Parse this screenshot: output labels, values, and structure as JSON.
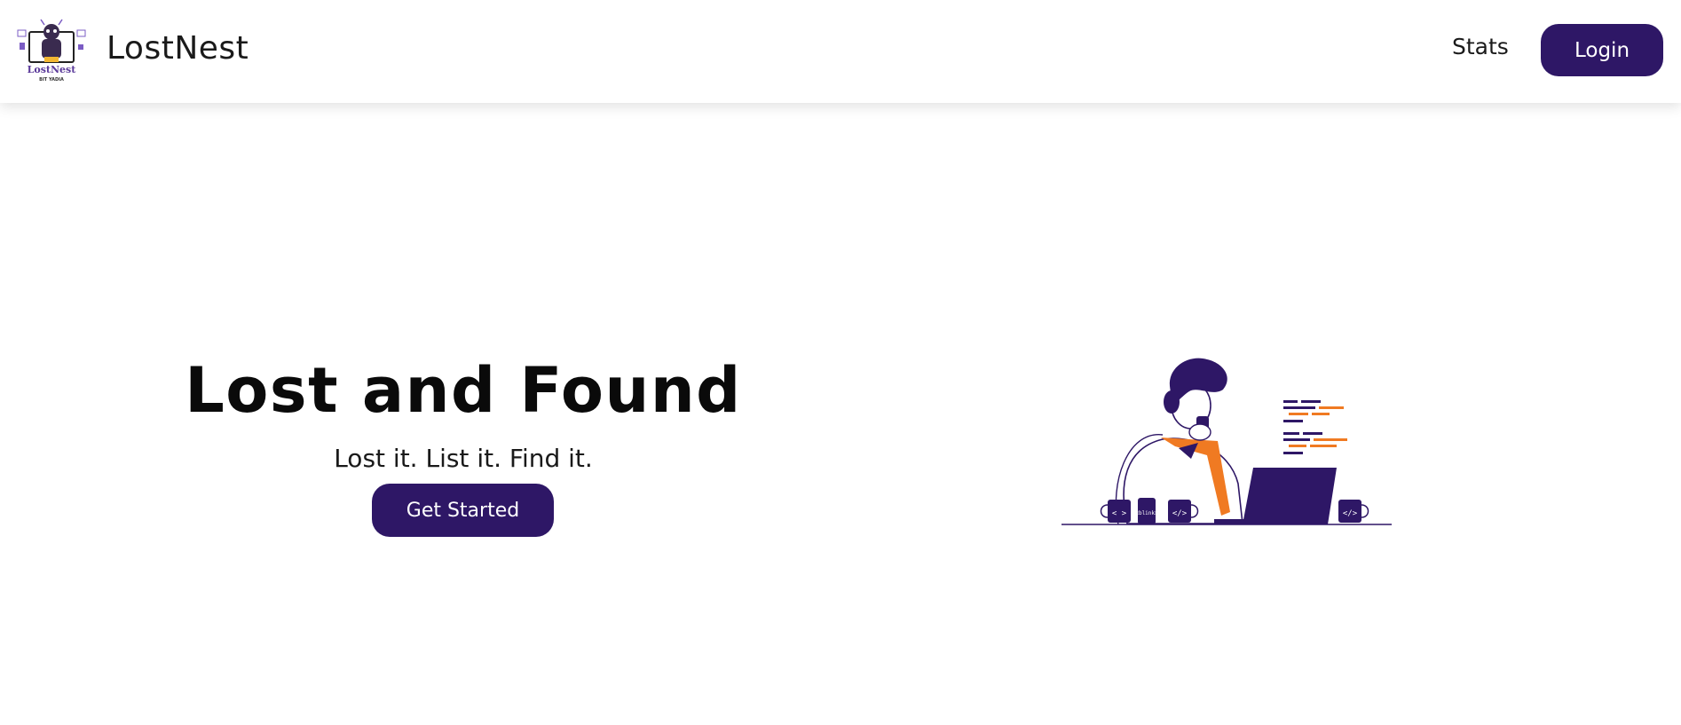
{
  "brand": {
    "name": "LostNest",
    "logo_text": "LostNest",
    "logo_subtext": "BIT YADIA"
  },
  "nav": {
    "stats_label": "Stats",
    "login_label": "Login"
  },
  "hero": {
    "title": "Lost and Found",
    "tagline": "Lost it. List it. Find it.",
    "cta_label": "Get Started"
  },
  "colors": {
    "primary": "#2e1766",
    "accent": "#f07a22",
    "background": "#ffffff"
  },
  "illustration": {
    "mug_labels": [
      "< >",
      "</>",
      "</>"
    ],
    "can_label": "<blink>"
  }
}
